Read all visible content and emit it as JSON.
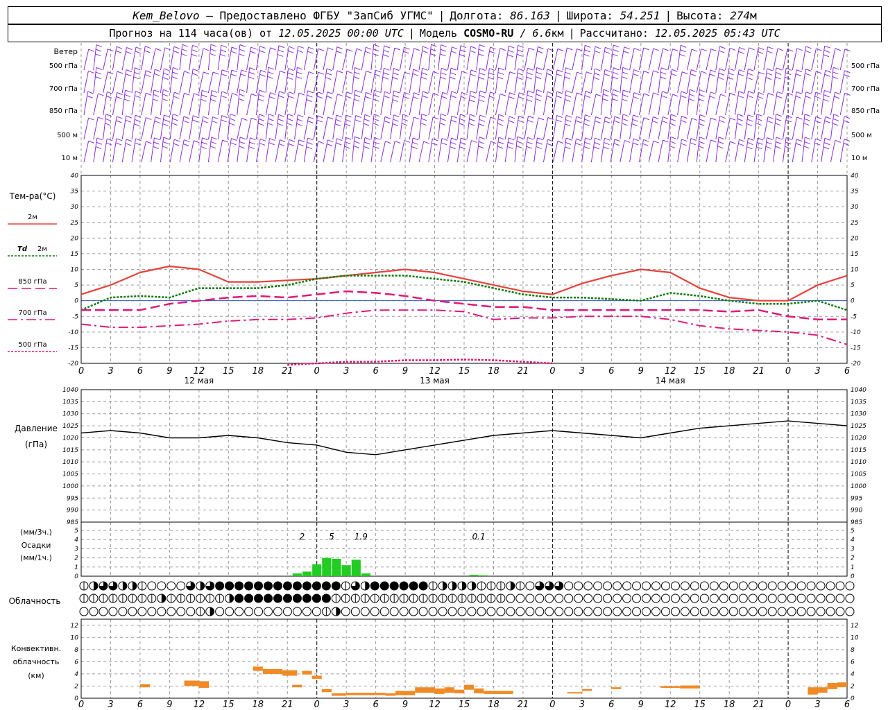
{
  "header": {
    "station": "Kem_Belovo",
    "provider": "– Предоставлено ФГБУ \"ЗапСиб УГМС\"",
    "lon_label": "Долгота:",
    "lon": "86.163",
    "lat_label": "Широта:",
    "lat": "54.251",
    "alt_label": "Высота:",
    "alt": "274",
    "alt_unit": "м",
    "forecast_text": "Прогноз на 114 часа(ов) от",
    "forecast_date": "12.05.2025 00:00 UTC",
    "model_label": "Модель",
    "model": "COSMO-RU",
    "model_res": "/ 6.6",
    "model_res_unit": "км",
    "calc_label": "Рассчитано:",
    "calc_date": "12.05.2025 05:43 UTC"
  },
  "labels": {
    "wind": "Ветер",
    "wind_levels": [
      "500 гПа",
      "700 гПа",
      "850 гПа",
      "500 м",
      "10 м"
    ],
    "temp_title": "Тем-ра(°C)",
    "temp_2m": "2м",
    "td_prefix": "Td",
    "td_2m": "2м",
    "t850": "850 гПа",
    "t700": "700 гПа",
    "t500": "500 гПа",
    "pressure": "Давление",
    "pressure_unit": "(гПа)",
    "precip_unit3": "(мм/3ч.)",
    "precip": "Осадки",
    "precip_unit1": "(мм/1ч.)",
    "cloud": "Облачность",
    "conv1": "Конвективн.",
    "conv2": "облачность",
    "conv3": "(км)",
    "days": [
      "12 мая",
      "13 мая",
      "14 мая"
    ],
    "hour_ticks": [
      "0",
      "3",
      "6",
      "9",
      "12",
      "15",
      "18",
      "21",
      "0",
      "3",
      "6",
      "9",
      "12",
      "15",
      "18",
      "21",
      "0",
      "3",
      "6",
      "9",
      "12",
      "15",
      "18",
      "21",
      "0",
      "3",
      "6"
    ]
  },
  "colors": {
    "wind": "#8a2be2",
    "t2m": "#e8413a",
    "td": "#0a7a0a",
    "t850": "#e0177a",
    "precip": "#22cc22",
    "conv": "#f08a24",
    "grid": "#9a9a9a"
  },
  "chart_data": [
    {
      "type": "line",
      "title": "Тем-ра(°C)",
      "ylim": [
        -20,
        40
      ],
      "yticks": [
        -20,
        -15,
        -10,
        -5,
        0,
        5,
        10,
        15,
        20,
        25,
        30,
        35,
        40
      ],
      "x_hours": [
        0,
        3,
        6,
        9,
        12,
        15,
        18,
        21,
        24,
        27,
        30,
        33,
        36,
        39,
        42,
        45,
        48,
        51,
        54,
        57,
        60,
        63,
        66,
        69,
        72,
        75,
        78
      ],
      "series": [
        {
          "name": "2м",
          "values": [
            2,
            5,
            9,
            11,
            10,
            6,
            6,
            6.5,
            7,
            8,
            9,
            10,
            9,
            7,
            5,
            3,
            2,
            5.5,
            8,
            10,
            9,
            4,
            1,
            0,
            0,
            5,
            8
          ]
        },
        {
          "name": "Td 2м",
          "values": [
            -3,
            1,
            1.5,
            1,
            4,
            4,
            4,
            5,
            7,
            8,
            8,
            8,
            7,
            6,
            4,
            2,
            1,
            1,
            0.5,
            0,
            2.5,
            1.5,
            0,
            -1,
            -1,
            0,
            -3
          ]
        },
        {
          "name": "850 гПа",
          "values": [
            -3,
            -3,
            -3,
            -1,
            0,
            1,
            1.5,
            1,
            2,
            3,
            2.5,
            1.5,
            0,
            -1,
            -2,
            -2,
            -3,
            -3,
            -3,
            -3,
            -3,
            -3,
            -3.5,
            -3,
            -5,
            -6,
            -6
          ]
        },
        {
          "name": "700 гПа",
          "values": [
            -7.5,
            -8.5,
            -8.5,
            -8,
            -7.5,
            -6.5,
            -6,
            -6,
            -5.5,
            -4,
            -3,
            -3,
            -3,
            -3.5,
            -6,
            -5.5,
            -5.5,
            -5,
            -5,
            -5,
            -6,
            -8,
            -9,
            -9.5,
            -10,
            -11,
            -14
          ]
        },
        {
          "name": "500 гПа",
          "values": [
            null,
            null,
            null,
            null,
            null,
            null,
            null,
            -20.5,
            -20,
            -19.5,
            -19.5,
            -19,
            -19,
            -18.8,
            -19,
            -19.5,
            -20,
            null,
            null,
            null,
            null,
            null,
            null,
            null,
            null,
            null,
            null
          ]
        }
      ]
    },
    {
      "type": "line",
      "title": "Давление",
      "ylabel": "(гПа)",
      "ylim": [
        985,
        1040
      ],
      "yticks": [
        985,
        990,
        995,
        1000,
        1005,
        1010,
        1015,
        1020,
        1025,
        1030,
        1035,
        1040
      ],
      "x_hours": [
        0,
        3,
        6,
        9,
        12,
        15,
        18,
        21,
        24,
        27,
        30,
        33,
        36,
        39,
        42,
        45,
        48,
        51,
        54,
        57,
        60,
        63,
        66,
        69,
        72,
        75,
        78
      ],
      "values": [
        1022,
        1023,
        1022,
        1020,
        1020,
        1021,
        1020,
        1018,
        1017,
        1014,
        1013,
        1015,
        1017,
        1019,
        1021,
        1022,
        1023,
        1022,
        1021,
        1020,
        1022,
        1024,
        1025,
        1026,
        1027,
        1026,
        1025
      ]
    },
    {
      "type": "bar",
      "title": "Осадки",
      "ylim": [
        0,
        5
      ],
      "yticks": [
        0,
        1,
        2,
        3,
        4,
        5
      ],
      "hours": [
        22,
        23,
        24,
        25,
        26,
        27,
        28,
        29,
        40,
        41
      ],
      "values": [
        0.3,
        0.5,
        1.3,
        2.0,
        1.9,
        1.2,
        1.8,
        0.3,
        0.15,
        0.1
      ],
      "annotations_3h": [
        {
          "hour": 22.5,
          "text": "2"
        },
        {
          "hour": 25.5,
          "text": "5"
        },
        {
          "hour": 28.5,
          "text": "1.9"
        },
        {
          "hour": 40.5,
          "text": "0.1"
        }
      ]
    },
    {
      "type": "table",
      "title": "Облачность",
      "rows": [
        [
          1,
          2,
          3,
          3,
          2,
          2,
          1,
          0,
          0,
          0,
          0,
          3,
          2,
          3,
          4,
          4,
          4,
          4,
          4,
          4,
          4,
          4,
          4,
          4,
          4,
          4,
          4,
          1,
          3,
          2,
          4,
          4,
          4,
          4,
          4,
          4,
          1,
          2,
          2,
          2,
          2,
          1,
          1,
          1,
          2,
          1,
          0,
          3,
          3,
          3,
          0,
          0,
          0,
          0,
          0,
          0,
          0,
          0,
          0,
          0,
          0,
          0,
          0,
          0,
          0,
          0,
          0,
          0,
          0,
          0,
          0,
          0,
          0,
          0,
          0,
          0,
          0,
          0,
          0,
          0
        ],
        [
          1,
          1,
          1,
          1,
          1,
          1,
          1,
          1,
          2,
          1,
          1,
          1,
          1,
          1,
          1,
          2,
          4,
          4,
          4,
          4,
          4,
          4,
          4,
          4,
          4,
          4,
          1,
          1,
          1,
          1,
          1,
          1,
          1,
          1,
          1,
          1,
          1,
          1,
          1,
          1,
          1,
          1,
          1,
          1,
          0,
          0,
          0,
          0,
          0,
          0,
          0,
          0,
          0,
          0,
          0,
          0,
          0,
          0,
          0,
          0,
          0,
          0,
          0,
          0,
          0,
          0,
          0,
          0,
          0,
          0,
          0,
          0,
          0,
          0,
          0,
          0,
          0,
          0,
          0,
          0
        ],
        [
          0,
          0,
          0,
          0,
          0,
          0,
          0,
          0,
          0,
          0,
          0,
          0,
          1,
          2,
          0,
          0,
          0,
          0,
          0,
          0,
          0,
          0,
          0,
          0,
          0,
          1,
          2,
          0,
          0,
          0,
          0,
          0,
          0,
          0,
          0,
          0,
          0,
          0,
          0,
          0,
          0,
          0,
          0,
          0,
          0,
          0,
          0,
          0,
          0,
          0,
          0,
          0,
          0,
          0,
          0,
          0,
          0,
          0,
          0,
          0,
          0,
          0,
          0,
          0,
          0,
          0,
          0,
          0,
          0,
          0,
          0,
          0,
          0,
          0,
          0,
          0,
          0,
          0,
          0,
          0
        ]
      ]
    },
    {
      "type": "bar",
      "title": "Конвективн. облачность",
      "ylabel": "(км)",
      "ylim": [
        0,
        13
      ],
      "yticks": [
        0,
        2,
        4,
        6,
        8,
        10,
        12
      ],
      "segments": [
        {
          "h0": 6,
          "h1": 7,
          "base": 1.8,
          "top": 2.3
        },
        {
          "h0": 10.5,
          "h1": 12,
          "base": 2.0,
          "top": 2.9
        },
        {
          "h0": 12,
          "h1": 13,
          "base": 1.7,
          "top": 2.8
        },
        {
          "h0": 17.5,
          "h1": 18.5,
          "base": 4.5,
          "top": 5.2
        },
        {
          "h0": 18.5,
          "h1": 20.5,
          "base": 4.0,
          "top": 4.8
        },
        {
          "h0": 20.5,
          "h1": 22,
          "base": 3.7,
          "top": 4.6
        },
        {
          "h0": 21.5,
          "h1": 22.5,
          "base": 1.8,
          "top": 2.2
        },
        {
          "h0": 22.5,
          "h1": 23.5,
          "base": 3.9,
          "top": 4.5
        },
        {
          "h0": 23.5,
          "h1": 24.5,
          "base": 3.2,
          "top": 3.7
        },
        {
          "h0": 24.5,
          "h1": 25.5,
          "base": 1.0,
          "top": 1.5
        },
        {
          "h0": 25.5,
          "h1": 27,
          "base": 0.4,
          "top": 0.8
        },
        {
          "h0": 27,
          "h1": 31,
          "base": 0.5,
          "top": 0.9
        },
        {
          "h0": 31,
          "h1": 32,
          "base": 0.4,
          "top": 0.8
        },
        {
          "h0": 32,
          "h1": 34,
          "base": 0.5,
          "top": 1.2
        },
        {
          "h0": 34,
          "h1": 36,
          "base": 0.9,
          "top": 1.8
        },
        {
          "h0": 36,
          "h1": 37,
          "base": 0.7,
          "top": 1.6
        },
        {
          "h0": 37,
          "h1": 38,
          "base": 0.9,
          "top": 1.8
        },
        {
          "h0": 38,
          "h1": 39,
          "base": 0.8,
          "top": 1.4
        },
        {
          "h0": 39,
          "h1": 40,
          "base": 1.4,
          "top": 2.2
        },
        {
          "h0": 40,
          "h1": 41,
          "base": 0.8,
          "top": 1.6
        },
        {
          "h0": 41,
          "h1": 44,
          "base": 0.7,
          "top": 1.2
        },
        {
          "h0": 49.5,
          "h1": 51,
          "base": 0.8,
          "top": 1.0
        },
        {
          "h0": 51,
          "h1": 52,
          "base": 1.2,
          "top": 1.5
        },
        {
          "h0": 54,
          "h1": 55,
          "base": 1.5,
          "top": 1.8
        },
        {
          "h0": 59,
          "h1": 61,
          "base": 1.7,
          "top": 2.0
        },
        {
          "h0": 61,
          "h1": 63,
          "base": 1.6,
          "top": 2.1
        },
        {
          "h0": 74,
          "h1": 75,
          "base": 0.6,
          "top": 1.8
        },
        {
          "h0": 75,
          "h1": 76,
          "base": 0.9,
          "top": 1.8
        },
        {
          "h0": 76,
          "h1": 77,
          "base": 1.5,
          "top": 2.5
        },
        {
          "h0": 77,
          "h1": 78,
          "base": 1.8,
          "top": 2.6
        }
      ]
    }
  ]
}
